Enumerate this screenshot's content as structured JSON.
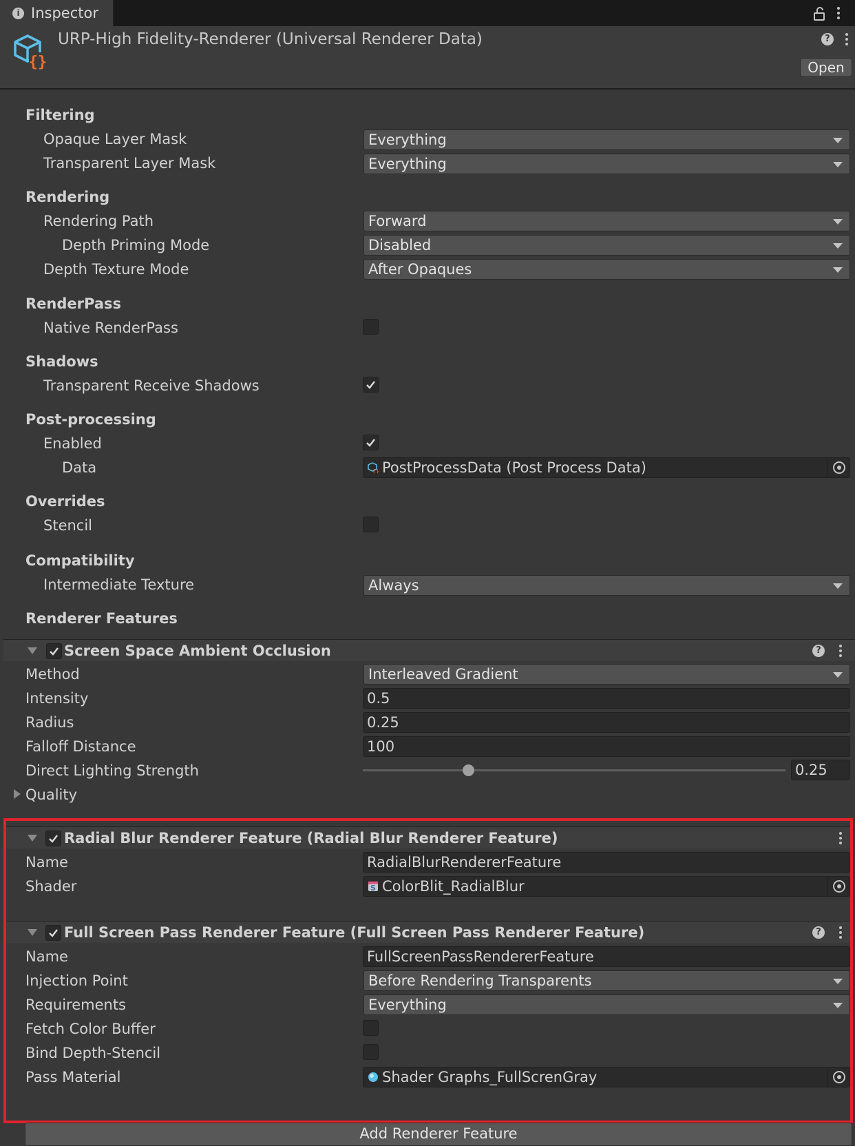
{
  "tab": {
    "label": "Inspector"
  },
  "header": {
    "title": "URP-High Fidelity-Renderer (Universal Renderer Data)",
    "open_label": "Open"
  },
  "sections": {
    "filtering": "Filtering",
    "rendering": "Rendering",
    "renderpass": "RenderPass",
    "shadows": "Shadows",
    "postprocessing": "Post-processing",
    "overrides": "Overrides",
    "compatibility": "Compatibility",
    "renderer_features": "Renderer Features"
  },
  "fields": {
    "opaque_layer_mask": {
      "label": "Opaque Layer Mask",
      "value": "Everything"
    },
    "transparent_layer_mask": {
      "label": "Transparent Layer Mask",
      "value": "Everything"
    },
    "rendering_path": {
      "label": "Rendering Path",
      "value": "Forward"
    },
    "depth_priming_mode": {
      "label": "Depth Priming Mode",
      "value": "Disabled"
    },
    "depth_texture_mode": {
      "label": "Depth Texture Mode",
      "value": "After Opaques"
    },
    "native_renderpass": {
      "label": "Native RenderPass",
      "checked": false
    },
    "transparent_receive_shadows": {
      "label": "Transparent Receive Shadows",
      "checked": true
    },
    "pp_enabled": {
      "label": "Enabled",
      "checked": true
    },
    "pp_data": {
      "label": "Data",
      "value": "PostProcessData (Post Process Data)"
    },
    "stencil": {
      "label": "Stencil",
      "checked": false
    },
    "intermediate_texture": {
      "label": "Intermediate Texture",
      "value": "Always"
    }
  },
  "ssao": {
    "title": "Screen Space Ambient Occlusion",
    "enabled": true,
    "method": {
      "label": "Method",
      "value": "Interleaved Gradient"
    },
    "intensity": {
      "label": "Intensity",
      "value": "0.5"
    },
    "radius": {
      "label": "Radius",
      "value": "0.25"
    },
    "falloff": {
      "label": "Falloff Distance",
      "value": "100"
    },
    "direct_lighting": {
      "label": "Direct Lighting Strength",
      "value": "0.25",
      "slider_fraction": 0.25
    },
    "quality": {
      "label": "Quality"
    }
  },
  "radial_blur": {
    "title": "Radial Blur Renderer Feature (Radial Blur Renderer Feature)",
    "enabled": true,
    "name": {
      "label": "Name",
      "value": "RadialBlurRendererFeature"
    },
    "shader": {
      "label": "Shader",
      "value": "ColorBlit_RadialBlur"
    }
  },
  "full_screen": {
    "title": "Full Screen Pass Renderer Feature (Full Screen Pass Renderer Feature)",
    "enabled": true,
    "name": {
      "label": "Name",
      "value": "FullScreenPassRendererFeature"
    },
    "injection_point": {
      "label": "Injection Point",
      "value": "Before Rendering Transparents"
    },
    "requirements": {
      "label": "Requirements",
      "value": "Everything"
    },
    "fetch_color_buffer": {
      "label": "Fetch Color Buffer",
      "checked": false
    },
    "bind_depth_stencil": {
      "label": "Bind Depth-Stencil",
      "checked": false
    },
    "pass_material": {
      "label": "Pass Material",
      "value": "Shader Graphs_FullScrenGray"
    }
  },
  "add_feature_label": "Add Renderer Feature",
  "colors": {
    "highlight_frame": "#e0232d",
    "panel_bg": "#383838",
    "accent_orange": "#f07030",
    "accent_blue": "#5cc0e8"
  }
}
